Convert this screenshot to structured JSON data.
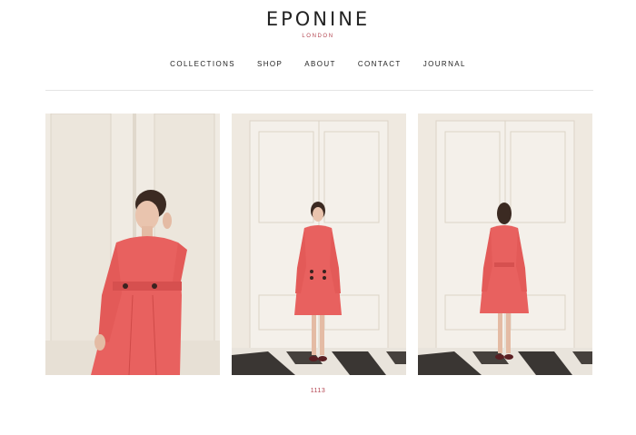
{
  "brand": {
    "name": "EPONINE",
    "location": "LONDON"
  },
  "nav": {
    "items": [
      "COLLECTIONS",
      "SHOP",
      "ABOUT",
      "CONTACT",
      "JOURNAL"
    ]
  },
  "gallery": {
    "images": [
      {
        "icon": "model-closeup-image"
      },
      {
        "icon": "model-front-image"
      },
      {
        "icon": "model-back-image"
      }
    ],
    "caption": "1113"
  },
  "colors": {
    "accent": "#b3434f",
    "dress": "#e8615f",
    "wall": "#efe9e0"
  }
}
